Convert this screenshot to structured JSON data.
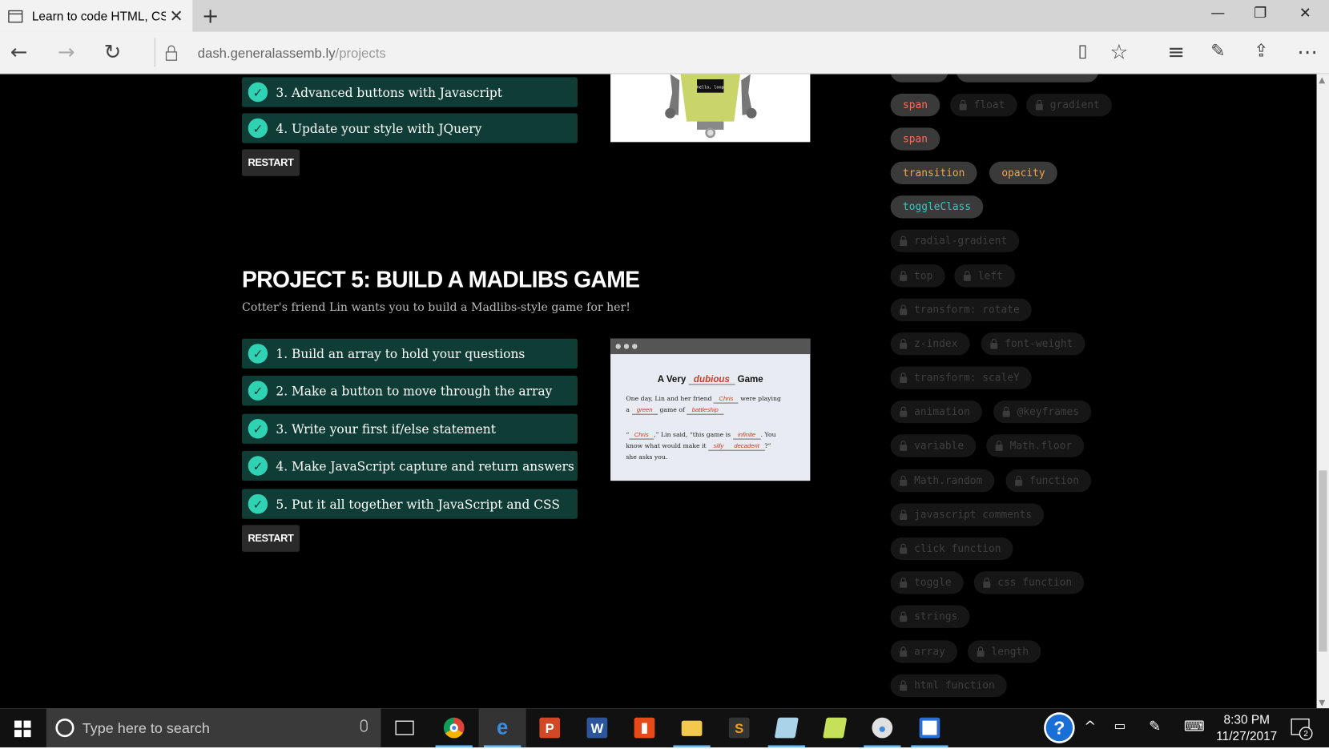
{
  "browser": {
    "tab_title": "Learn to code HTML, CS",
    "url_host": "dash.generalassemb.ly",
    "url_path": "/projects"
  },
  "project4": {
    "steps": [
      "3. Advanced buttons with Javascript",
      "4. Update your style with JQuery"
    ],
    "restart_label": "RESTART"
  },
  "project5": {
    "title": "PROJECT 5: BUILD A MADLIBS GAME",
    "description": "Cotter's friend Lin wants you to build a Madlibs-style game for her!",
    "steps": [
      "1. Build an array to hold your questions",
      "2. Make a button to move through the array",
      "3. Write your first if/else statement",
      "4. Make JavaScript capture and return answers",
      "5. Put it all together with JavaScript and CSS"
    ],
    "restart_label": "RESTART",
    "preview": {
      "title_a": "A Very",
      "title_blank": "dubious",
      "title_b": "Game",
      "line1_a": "One day, Lin and her friend",
      "line1_blank": "Chris",
      "line1_b": "were playing",
      "line2_a": "a",
      "line2_blank1": "green",
      "line2_b": "game of",
      "line2_blank2": "battleship",
      "line3_a": "“",
      "line3_blank": "Chris",
      "line3_b": ",” Lin said, “this game is",
      "line3_blank2": "infinite",
      "line3_c": ". You",
      "line4_a": "know what would make it",
      "line4_blank1": "silly",
      "line4_blank2": "decadent",
      "line4_b": "?”",
      "line5": "she asks you."
    }
  },
  "robot_screen_text": "hello, loop",
  "tags": [
    {
      "label": "span",
      "state": "unlocked",
      "color": "red"
    },
    {
      "label": "float",
      "state": "locked"
    },
    {
      "label": "gradient",
      "state": "locked"
    },
    {
      "label": "span",
      "state": "unlocked",
      "color": "red"
    },
    {
      "label": "transition",
      "state": "unlocked",
      "color": "orange"
    },
    {
      "label": "opacity",
      "state": "unlocked",
      "color": "orange"
    },
    {
      "label": "toggleClass",
      "state": "unlocked",
      "color": "teal"
    },
    {
      "label": "radial-gradient",
      "state": "locked"
    },
    {
      "label": "top",
      "state": "locked"
    },
    {
      "label": "left",
      "state": "locked"
    },
    {
      "label": "transform: rotate",
      "state": "locked"
    },
    {
      "label": "z-index",
      "state": "locked"
    },
    {
      "label": "font-weight",
      "state": "locked"
    },
    {
      "label": "transform: scaleY",
      "state": "locked"
    },
    {
      "label": "animation",
      "state": "locked"
    },
    {
      "label": "@keyframes",
      "state": "locked"
    },
    {
      "label": "variable",
      "state": "locked"
    },
    {
      "label": "Math.floor",
      "state": "locked"
    },
    {
      "label": "Math.random",
      "state": "locked"
    },
    {
      "label": "function",
      "state": "locked"
    },
    {
      "label": "javascript comments",
      "state": "locked"
    },
    {
      "label": "click function",
      "state": "locked"
    },
    {
      "label": "toggle",
      "state": "locked"
    },
    {
      "label": "css function",
      "state": "locked"
    },
    {
      "label": "strings",
      "state": "locked"
    },
    {
      "label": "array",
      "state": "locked"
    },
    {
      "label": "length",
      "state": "locked"
    },
    {
      "label": "html function",
      "state": "locked"
    }
  ],
  "taskbar": {
    "search_placeholder": "Type here to search",
    "time": "8:30 PM",
    "date": "11/27/2017",
    "notification_count": "2"
  },
  "colors": {
    "step_bg": "#0f3d36",
    "check": "#2fd3b4",
    "tag_red": "#ff6b5a",
    "tag_orange": "#f0a646",
    "tag_teal": "#34c9c2"
  }
}
